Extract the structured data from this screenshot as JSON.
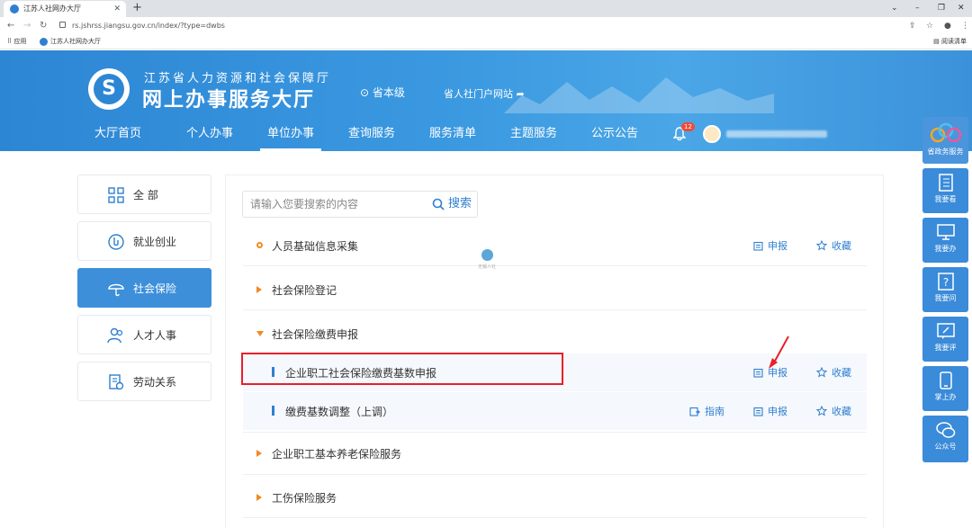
{
  "browser": {
    "tab_title": "江苏人社网办大厅",
    "close_glyph": "✕",
    "newtab_glyph": "+",
    "url": "rs.jshrss.jiangsu.gov.cn/index/?type=dwbs",
    "bookmark_apps": "应用",
    "bookmark_site": "江苏人社网办大厅",
    "reading_list": "阅读清单"
  },
  "header": {
    "org_name": "江苏省人力资源和社会保障厅",
    "hall_name": "网上办事服务大厅",
    "region": "省本级",
    "portal_link": "省人社门户网站",
    "notification_count": "12"
  },
  "topnav": [
    {
      "label": "大厅首页"
    },
    {
      "label": "个人办事"
    },
    {
      "label": "单位办事"
    },
    {
      "label": "查询服务"
    },
    {
      "label": "服务清单"
    },
    {
      "label": "主题服务"
    },
    {
      "label": "公示公告"
    }
  ],
  "categories": [
    {
      "label": "全 部"
    },
    {
      "label": "就业创业"
    },
    {
      "label": "社会保险"
    },
    {
      "label": "人才人事"
    },
    {
      "label": "劳动关系"
    }
  ],
  "search": {
    "placeholder": "请输入您要搜索的内容",
    "button": "搜索"
  },
  "services": {
    "row1": "人员基础信息采集",
    "row2": "社会保险登记",
    "row3": "社会保险缴费申报",
    "sub1": "企业职工社会保险缴费基数申报",
    "sub2": "缴费基数调整（上调）",
    "row4": "企业职工基本养老保险服务",
    "row5": "工伤保险服务"
  },
  "actions": {
    "apply": "申报",
    "favorite": "收藏",
    "guide": "指南"
  },
  "watermark": "无锡人社",
  "float_menu": [
    {
      "label": "省政务服务"
    },
    {
      "label": "我要看"
    },
    {
      "label": "我要办"
    },
    {
      "label": "我要问"
    },
    {
      "label": "我要评"
    },
    {
      "label": "掌上办"
    },
    {
      "label": "公众号"
    }
  ],
  "colors": {
    "brand_blue": "#2f7fd0",
    "header_blue": "#3a98e0",
    "accent_orange": "#f08a24",
    "highlight_red": "#e8202a"
  }
}
